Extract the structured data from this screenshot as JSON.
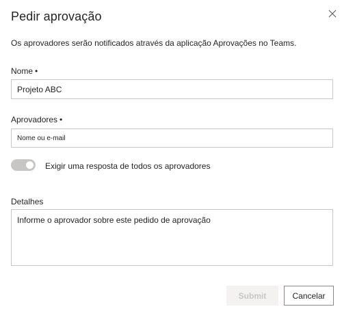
{
  "dialog": {
    "title": "Pedir aprovação",
    "description": "Os aprovadores serão notificados através da aplicação Aprovações no Teams."
  },
  "fields": {
    "name": {
      "label": "Nome",
      "required_mark": "•",
      "value": "Projeto ABC"
    },
    "approvers": {
      "label": "Aprovadores",
      "required_mark": "•",
      "placeholder": "Nome ou e-mail"
    },
    "require_all": {
      "label": "Exigir uma resposta de todos os aprovadores",
      "state": "on-disabled"
    },
    "details": {
      "label": "Detalhes",
      "placeholder": "Informe o aprovador sobre este pedido de aprovação"
    }
  },
  "buttons": {
    "submit": "Submit",
    "cancel": "Cancelar"
  },
  "icons": {
    "close": "close-icon"
  },
  "colors": {
    "border": "#c8c6c4",
    "text": "#252423",
    "disabled_bg": "#f3f2f1",
    "disabled_text": "#c8c6c4"
  }
}
